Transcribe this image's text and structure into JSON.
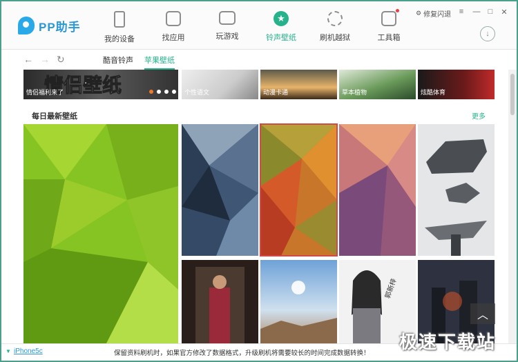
{
  "app": {
    "name": "PP助手"
  },
  "nav": {
    "items": [
      {
        "label": "我的设备",
        "icon": "phone-icon"
      },
      {
        "label": "找应用",
        "icon": "bag-icon"
      },
      {
        "label": "玩游戏",
        "icon": "gamepad-icon"
      },
      {
        "label": "铃声壁纸",
        "icon": "star-icon",
        "active": true
      },
      {
        "label": "刷机越狱",
        "icon": "refresh-icon"
      },
      {
        "label": "工具箱",
        "icon": "toolbox-icon"
      }
    ]
  },
  "titlebar": {
    "repair_label": "修复闪退",
    "menu": "≡",
    "minimize": "—",
    "maximize": "□",
    "close": "✕"
  },
  "subbar": {
    "tabs": [
      {
        "label": "酷音铃声"
      },
      {
        "label": "苹果壁纸",
        "active": true
      }
    ]
  },
  "banners": [
    {
      "caption": "情侣福利来了"
    },
    {
      "caption": "个性语文"
    },
    {
      "caption": "动漫卡通"
    },
    {
      "caption": "草本植物"
    },
    {
      "caption": "炫酷体育"
    }
  ],
  "section": {
    "title": "每日最新壁纸",
    "more": "更多"
  },
  "statusbar": {
    "device": "iPhone5c",
    "notice_prefix": "保留资料刷机时，如果官方修改了数据格式，升级刷机将需要较长的时间完成数据转换！"
  },
  "watermark": "极速下载站",
  "colors": {
    "accent": "#26b38c",
    "brand": "#2a97d6",
    "border": "#49a08b",
    "selected_outline": "#d14a4a"
  }
}
